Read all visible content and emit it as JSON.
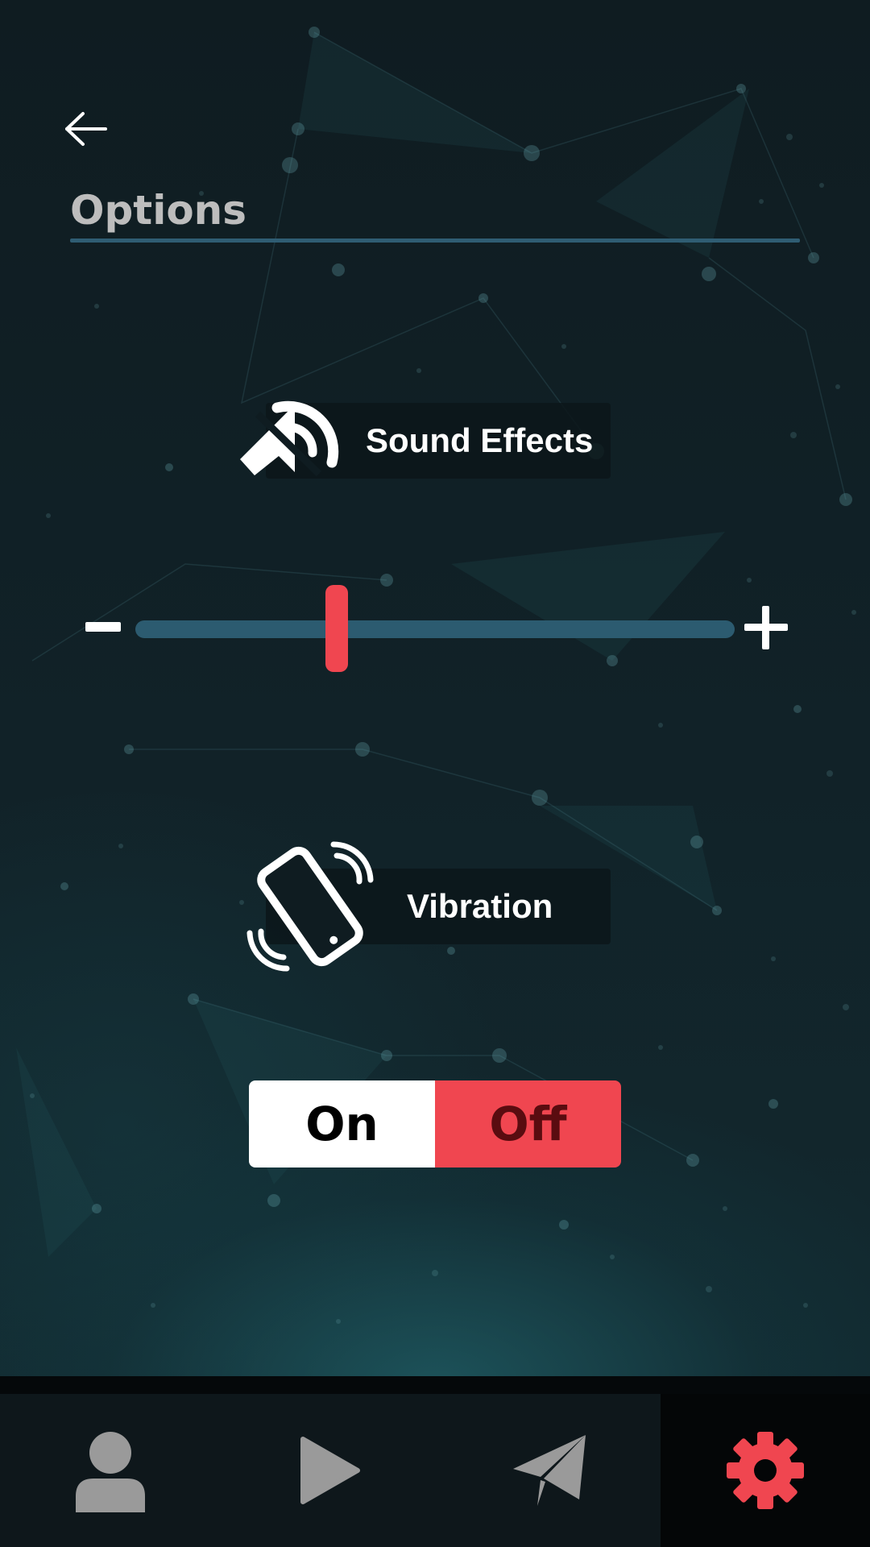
{
  "header": {
    "back_icon": "arrow-left-icon",
    "title": "Options"
  },
  "sound": {
    "icon": "speaker-muted-icon",
    "label": "Sound Effects",
    "volume_fraction": 0.33,
    "minus_label": "−",
    "plus_label": "+"
  },
  "vibration": {
    "icon": "phone-vibrate-icon",
    "label": "Vibration",
    "on_label": "On",
    "off_label": "Off",
    "selected": "Off"
  },
  "nav": {
    "items": [
      {
        "icon": "profile-icon",
        "active": false
      },
      {
        "icon": "play-icon",
        "active": false
      },
      {
        "icon": "send-icon",
        "active": false
      },
      {
        "icon": "gear-icon",
        "active": true
      }
    ]
  },
  "colors": {
    "accent": "#f04650",
    "track": "#2c5b70",
    "title": "#bdbdbd",
    "nav_inactive": "#9a9a9a"
  }
}
